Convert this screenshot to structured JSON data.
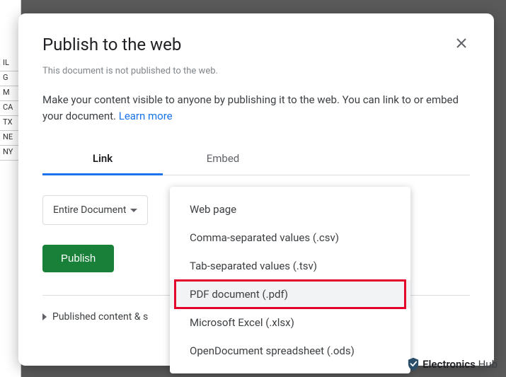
{
  "sheet_rows": [
    "IL",
    "G",
    "M",
    "CA",
    "TX",
    "NE",
    "NY"
  ],
  "dialog": {
    "title": "Publish to the web",
    "status": "This document is not published to the web.",
    "description_prefix": "Make your content visible to anyone by publishing it to the web. You can link to or embed your document. ",
    "learn_more": "Learn more"
  },
  "tabs": {
    "link": "Link",
    "embed": "Embed"
  },
  "controls": {
    "scope_selector": "Entire Document",
    "publish": "Publish"
  },
  "expander": {
    "label": "Published content & s"
  },
  "format_menu": {
    "items": [
      "Web page",
      "Comma-separated values (.csv)",
      "Tab-separated values (.tsv)",
      "PDF document (.pdf)",
      "Microsoft Excel (.xlsx)",
      "OpenDocument spreadsheet (.ods)"
    ]
  },
  "watermark": {
    "text1": "Electronics",
    "text2": "Hub"
  }
}
